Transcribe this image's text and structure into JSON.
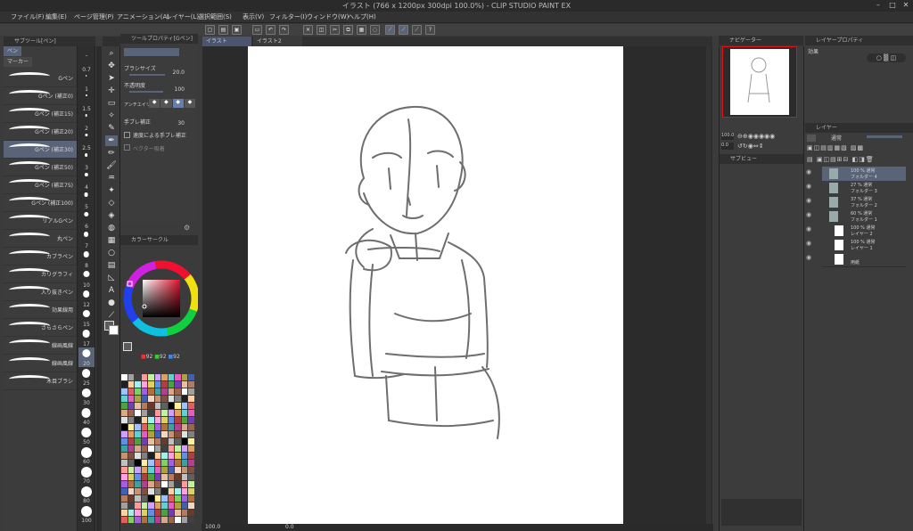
{
  "window": {
    "title": "イラスト (766 x 1200px 300dpi 100.0%) - CLIP STUDIO PAINT EX"
  },
  "menu": [
    "ファイル(F)",
    "編集(E)",
    "ページ管理(P)",
    "アニメーション(A)",
    "レイヤー(L)",
    "選択範囲(S)",
    "表示(V)",
    "フィルター(I)",
    "ウィンドウ(W)",
    "ヘルプ(H)"
  ],
  "subtool": {
    "header": "サブツール[ペン]",
    "tabs": [
      "ペン",
      "マーカー"
    ],
    "brushes": [
      "Gペン",
      "Gペン (補正0)",
      "Gペン (補正15)",
      "Gペン (補正20)",
      "Gペン (補正30)",
      "Gペン (補正50)",
      "Gペン (補正75)",
      "Gペン (補正100)",
      "リアルGペン",
      "丸ペン",
      "カブラペン",
      "カリグラフィ",
      "入り抜きペン",
      "効果線用",
      "さらさらペン",
      "線画風線",
      "線画風線",
      "木目ブラシ"
    ]
  },
  "sizes": [
    "0.7",
    "1",
    "1.5",
    "2",
    "2.5",
    "3",
    "4",
    "5",
    "6",
    "7",
    "8",
    "10",
    "12",
    "15",
    "17",
    "20",
    "25",
    "30",
    "40",
    "50",
    "60",
    "70",
    "80",
    "100"
  ],
  "toolprop": {
    "header": "ツールプロパティ[Gペン]",
    "brush_size_label": "ブラシサイズ",
    "brush_size": "20.0",
    "opacity_label": "不透明度",
    "opacity": "100",
    "antialias_label": "アンチエイリアス",
    "stabilization_label": "手ブレ補正",
    "stabilization": "30",
    "speed_label": "速度による手ブレ補正",
    "vector_label": "ベクター吸着"
  },
  "color": {
    "header": "カラーサークル",
    "r": "92",
    "g": "92",
    "b": "92"
  },
  "canvas_tabs": [
    "イラスト",
    "イラスト2"
  ],
  "navigator": {
    "header": "ナビゲーター",
    "zoom": "100.0",
    "angle": "0.0",
    "subview": "サブビュー"
  },
  "layerprop": {
    "header": "レイヤープロパティ",
    "effect": "効果"
  },
  "layers": {
    "header": "レイヤー",
    "blend": "通常",
    "items": [
      {
        "line1": "100 % 通常",
        "line2": "フォルダー 4"
      },
      {
        "line1": "27 % 通常",
        "line2": "フォルダー 3"
      },
      {
        "line1": "37 % 通常",
        "line2": "フォルダー 2"
      },
      {
        "line1": "60 % 通常",
        "line2": "フォルダー 1"
      },
      {
        "line1": "100 % 通常",
        "line2": "レイヤー 2"
      },
      {
        "line1": "100 % 通常",
        "line2": "レイヤー 1"
      },
      {
        "line1": "",
        "line2": "用紙"
      }
    ]
  },
  "status": {
    "zoom": "100.0",
    "angle": "0.0"
  }
}
